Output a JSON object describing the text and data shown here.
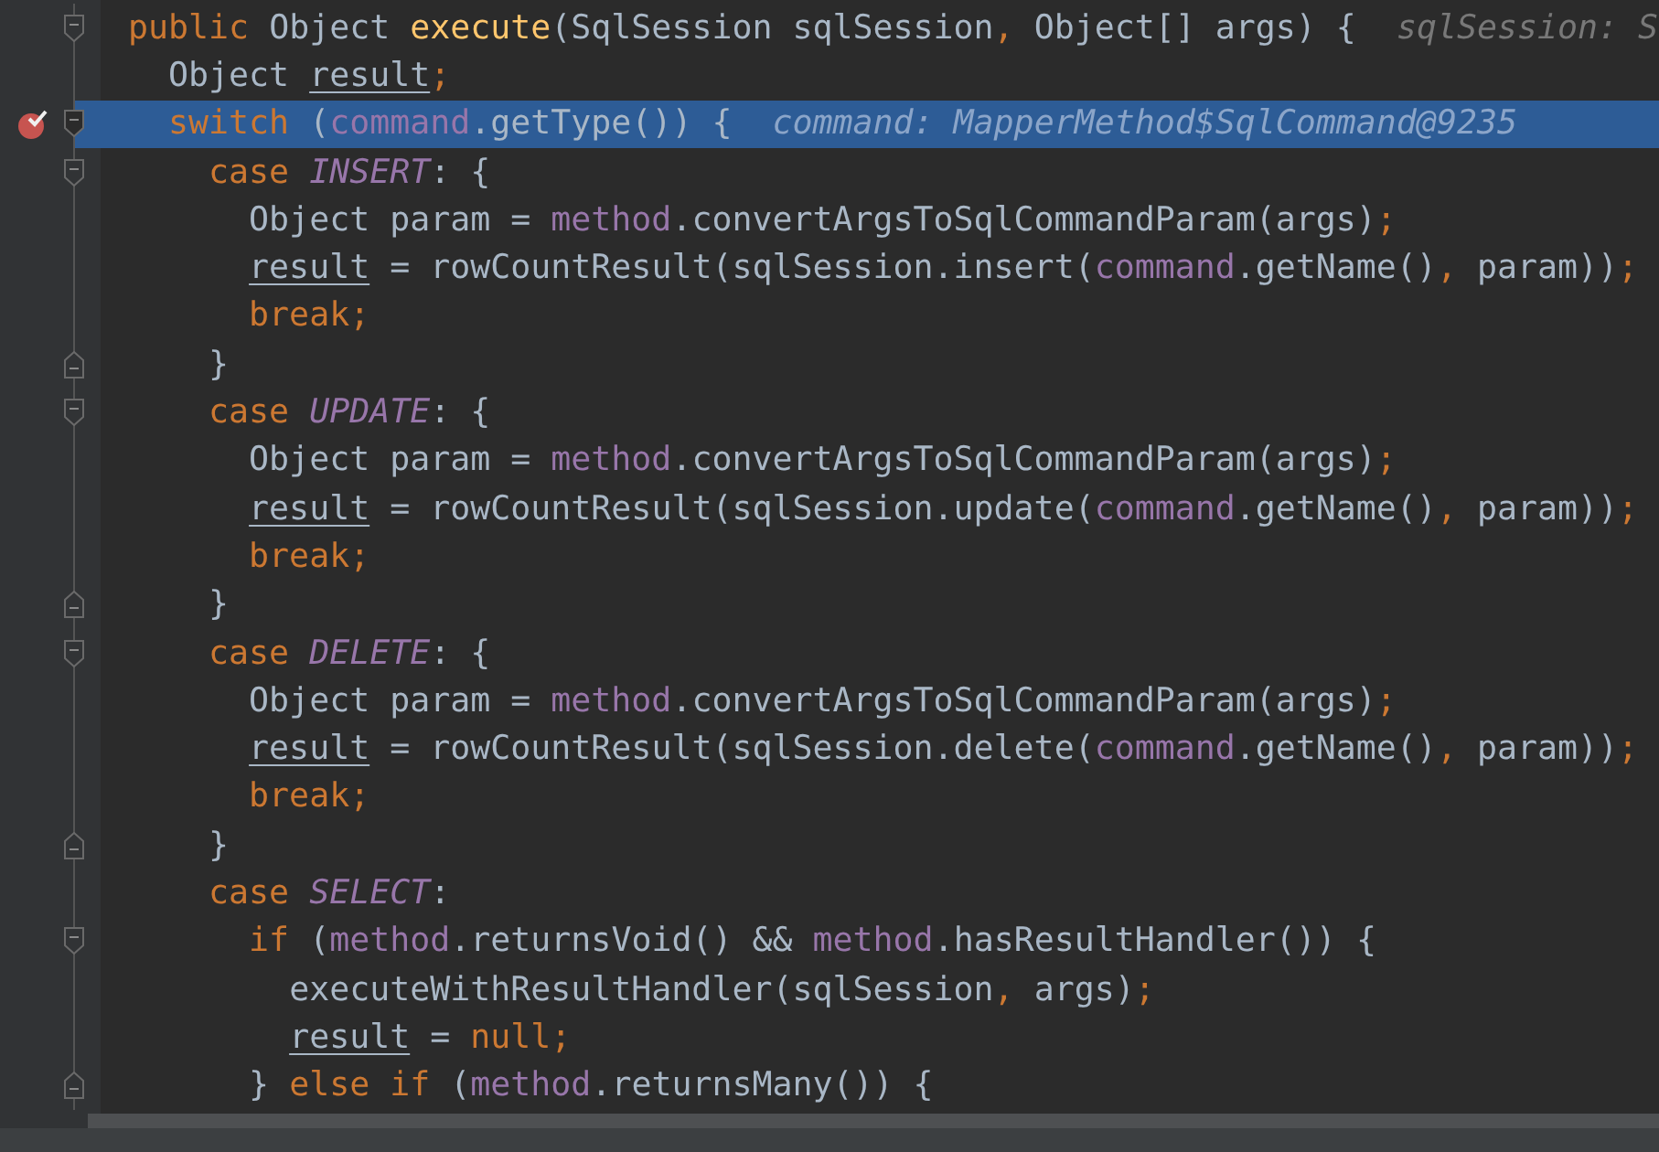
{
  "editor": {
    "lines": [
      {
        "highlighted": false,
        "breakpoint": false,
        "fold_start": true,
        "fold_end": false,
        "tokens": [
          {
            "kind": "kw",
            "text": "public"
          },
          {
            "kind": "plain",
            "text": " Object "
          },
          {
            "kind": "decl",
            "text": "execute"
          },
          {
            "kind": "plain",
            "text": "(SqlSession sqlSession"
          },
          {
            "kind": "punct",
            "text": ","
          },
          {
            "kind": "plain",
            "text": " Object[] args) {"
          }
        ],
        "hint": "sqlSession: S"
      },
      {
        "highlighted": false,
        "breakpoint": false,
        "fold_start": false,
        "fold_end": false,
        "tokens": [
          {
            "kind": "plain",
            "text": "  Object "
          },
          {
            "kind": "local",
            "text": "result"
          },
          {
            "kind": "punct",
            "text": ";"
          }
        ]
      },
      {
        "highlighted": true,
        "breakpoint": true,
        "fold_start": true,
        "fold_end": false,
        "tokens": [
          {
            "kind": "kw",
            "text": "  switch"
          },
          {
            "kind": "plain",
            "text": " ("
          },
          {
            "kind": "field",
            "text": "command"
          },
          {
            "kind": "plain",
            "text": ".getType()) {"
          }
        ],
        "hint": "command: MapperMethod$SqlCommand@9235"
      },
      {
        "highlighted": false,
        "breakpoint": false,
        "fold_start": true,
        "fold_end": false,
        "tokens": [
          {
            "kind": "kw",
            "text": "    case "
          },
          {
            "kind": "const",
            "text": "INSERT"
          },
          {
            "kind": "plain",
            "text": ": {"
          }
        ]
      },
      {
        "highlighted": false,
        "breakpoint": false,
        "fold_start": false,
        "fold_end": false,
        "tokens": [
          {
            "kind": "plain",
            "text": "      Object param = "
          },
          {
            "kind": "field",
            "text": "method"
          },
          {
            "kind": "plain",
            "text": ".convertArgsToSqlCommandParam(args)"
          },
          {
            "kind": "punct",
            "text": ";"
          }
        ]
      },
      {
        "highlighted": false,
        "breakpoint": false,
        "fold_start": false,
        "fold_end": false,
        "tokens": [
          {
            "kind": "local",
            "text": "      result"
          },
          {
            "kind": "plain",
            "text": " = rowCountResult(sqlSession.insert("
          },
          {
            "kind": "field",
            "text": "command"
          },
          {
            "kind": "plain",
            "text": ".getName()"
          },
          {
            "kind": "punct",
            "text": ","
          },
          {
            "kind": "plain",
            "text": " param))"
          },
          {
            "kind": "punct",
            "text": ";"
          }
        ]
      },
      {
        "highlighted": false,
        "breakpoint": false,
        "fold_start": false,
        "fold_end": false,
        "tokens": [
          {
            "kind": "kw",
            "text": "      break;"
          }
        ]
      },
      {
        "highlighted": false,
        "breakpoint": false,
        "fold_start": false,
        "fold_end": true,
        "tokens": [
          {
            "kind": "plain",
            "text": "    }"
          }
        ]
      },
      {
        "highlighted": false,
        "breakpoint": false,
        "fold_start": true,
        "fold_end": false,
        "tokens": [
          {
            "kind": "kw",
            "text": "    case "
          },
          {
            "kind": "const",
            "text": "UPDATE"
          },
          {
            "kind": "plain",
            "text": ": {"
          }
        ]
      },
      {
        "highlighted": false,
        "breakpoint": false,
        "fold_start": false,
        "fold_end": false,
        "tokens": [
          {
            "kind": "plain",
            "text": "      Object param = "
          },
          {
            "kind": "field",
            "text": "method"
          },
          {
            "kind": "plain",
            "text": ".convertArgsToSqlCommandParam(args)"
          },
          {
            "kind": "punct",
            "text": ";"
          }
        ]
      },
      {
        "highlighted": false,
        "breakpoint": false,
        "fold_start": false,
        "fold_end": false,
        "tokens": [
          {
            "kind": "local",
            "text": "      result"
          },
          {
            "kind": "plain",
            "text": " = rowCountResult(sqlSession.update("
          },
          {
            "kind": "field",
            "text": "command"
          },
          {
            "kind": "plain",
            "text": ".getName()"
          },
          {
            "kind": "punct",
            "text": ","
          },
          {
            "kind": "plain",
            "text": " param))"
          },
          {
            "kind": "punct",
            "text": ";"
          }
        ]
      },
      {
        "highlighted": false,
        "breakpoint": false,
        "fold_start": false,
        "fold_end": false,
        "tokens": [
          {
            "kind": "kw",
            "text": "      break;"
          }
        ]
      },
      {
        "highlighted": false,
        "breakpoint": false,
        "fold_start": false,
        "fold_end": true,
        "tokens": [
          {
            "kind": "plain",
            "text": "    }"
          }
        ]
      },
      {
        "highlighted": false,
        "breakpoint": false,
        "fold_start": true,
        "fold_end": false,
        "tokens": [
          {
            "kind": "kw",
            "text": "    case "
          },
          {
            "kind": "const",
            "text": "DELETE"
          },
          {
            "kind": "plain",
            "text": ": {"
          }
        ]
      },
      {
        "highlighted": false,
        "breakpoint": false,
        "fold_start": false,
        "fold_end": false,
        "tokens": [
          {
            "kind": "plain",
            "text": "      Object param = "
          },
          {
            "kind": "field",
            "text": "method"
          },
          {
            "kind": "plain",
            "text": ".convertArgsToSqlCommandParam(args)"
          },
          {
            "kind": "punct",
            "text": ";"
          }
        ]
      },
      {
        "highlighted": false,
        "breakpoint": false,
        "fold_start": false,
        "fold_end": false,
        "tokens": [
          {
            "kind": "local",
            "text": "      result"
          },
          {
            "kind": "plain",
            "text": " = rowCountResult(sqlSession.delete("
          },
          {
            "kind": "field",
            "text": "command"
          },
          {
            "kind": "plain",
            "text": ".getName()"
          },
          {
            "kind": "punct",
            "text": ","
          },
          {
            "kind": "plain",
            "text": " param))"
          },
          {
            "kind": "punct",
            "text": ";"
          }
        ]
      },
      {
        "highlighted": false,
        "breakpoint": false,
        "fold_start": false,
        "fold_end": false,
        "tokens": [
          {
            "kind": "kw",
            "text": "      break;"
          }
        ]
      },
      {
        "highlighted": false,
        "breakpoint": false,
        "fold_start": false,
        "fold_end": true,
        "tokens": [
          {
            "kind": "plain",
            "text": "    }"
          }
        ]
      },
      {
        "highlighted": false,
        "breakpoint": false,
        "fold_start": false,
        "fold_end": false,
        "tokens": [
          {
            "kind": "kw",
            "text": "    case "
          },
          {
            "kind": "const",
            "text": "SELECT"
          },
          {
            "kind": "plain",
            "text": ":"
          }
        ]
      },
      {
        "highlighted": false,
        "breakpoint": false,
        "fold_start": true,
        "fold_end": false,
        "tokens": [
          {
            "kind": "kw",
            "text": "      if"
          },
          {
            "kind": "plain",
            "text": " ("
          },
          {
            "kind": "field",
            "text": "method"
          },
          {
            "kind": "plain",
            "text": ".returnsVoid() && "
          },
          {
            "kind": "field",
            "text": "method"
          },
          {
            "kind": "plain",
            "text": ".hasResultHandler()) {"
          }
        ]
      },
      {
        "highlighted": false,
        "breakpoint": false,
        "fold_start": false,
        "fold_end": false,
        "tokens": [
          {
            "kind": "plain",
            "text": "        executeWithResultHandler(sqlSession"
          },
          {
            "kind": "punct",
            "text": ","
          },
          {
            "kind": "plain",
            "text": " args)"
          },
          {
            "kind": "punct",
            "text": ";"
          }
        ]
      },
      {
        "highlighted": false,
        "breakpoint": false,
        "fold_start": false,
        "fold_end": false,
        "tokens": [
          {
            "kind": "local",
            "text": "        result"
          },
          {
            "kind": "plain",
            "text": " = "
          },
          {
            "kind": "kw",
            "text": "null"
          },
          {
            "kind": "punct",
            "text": ";"
          }
        ]
      },
      {
        "highlighted": false,
        "breakpoint": false,
        "fold_start": false,
        "fold_end": true,
        "tokens": [
          {
            "kind": "plain",
            "text": "      } "
          },
          {
            "kind": "kw",
            "text": "else if"
          },
          {
            "kind": "plain",
            "text": " ("
          },
          {
            "kind": "field",
            "text": "method"
          },
          {
            "kind": "plain",
            "text": ".returnsMany()) {"
          }
        ]
      }
    ]
  }
}
